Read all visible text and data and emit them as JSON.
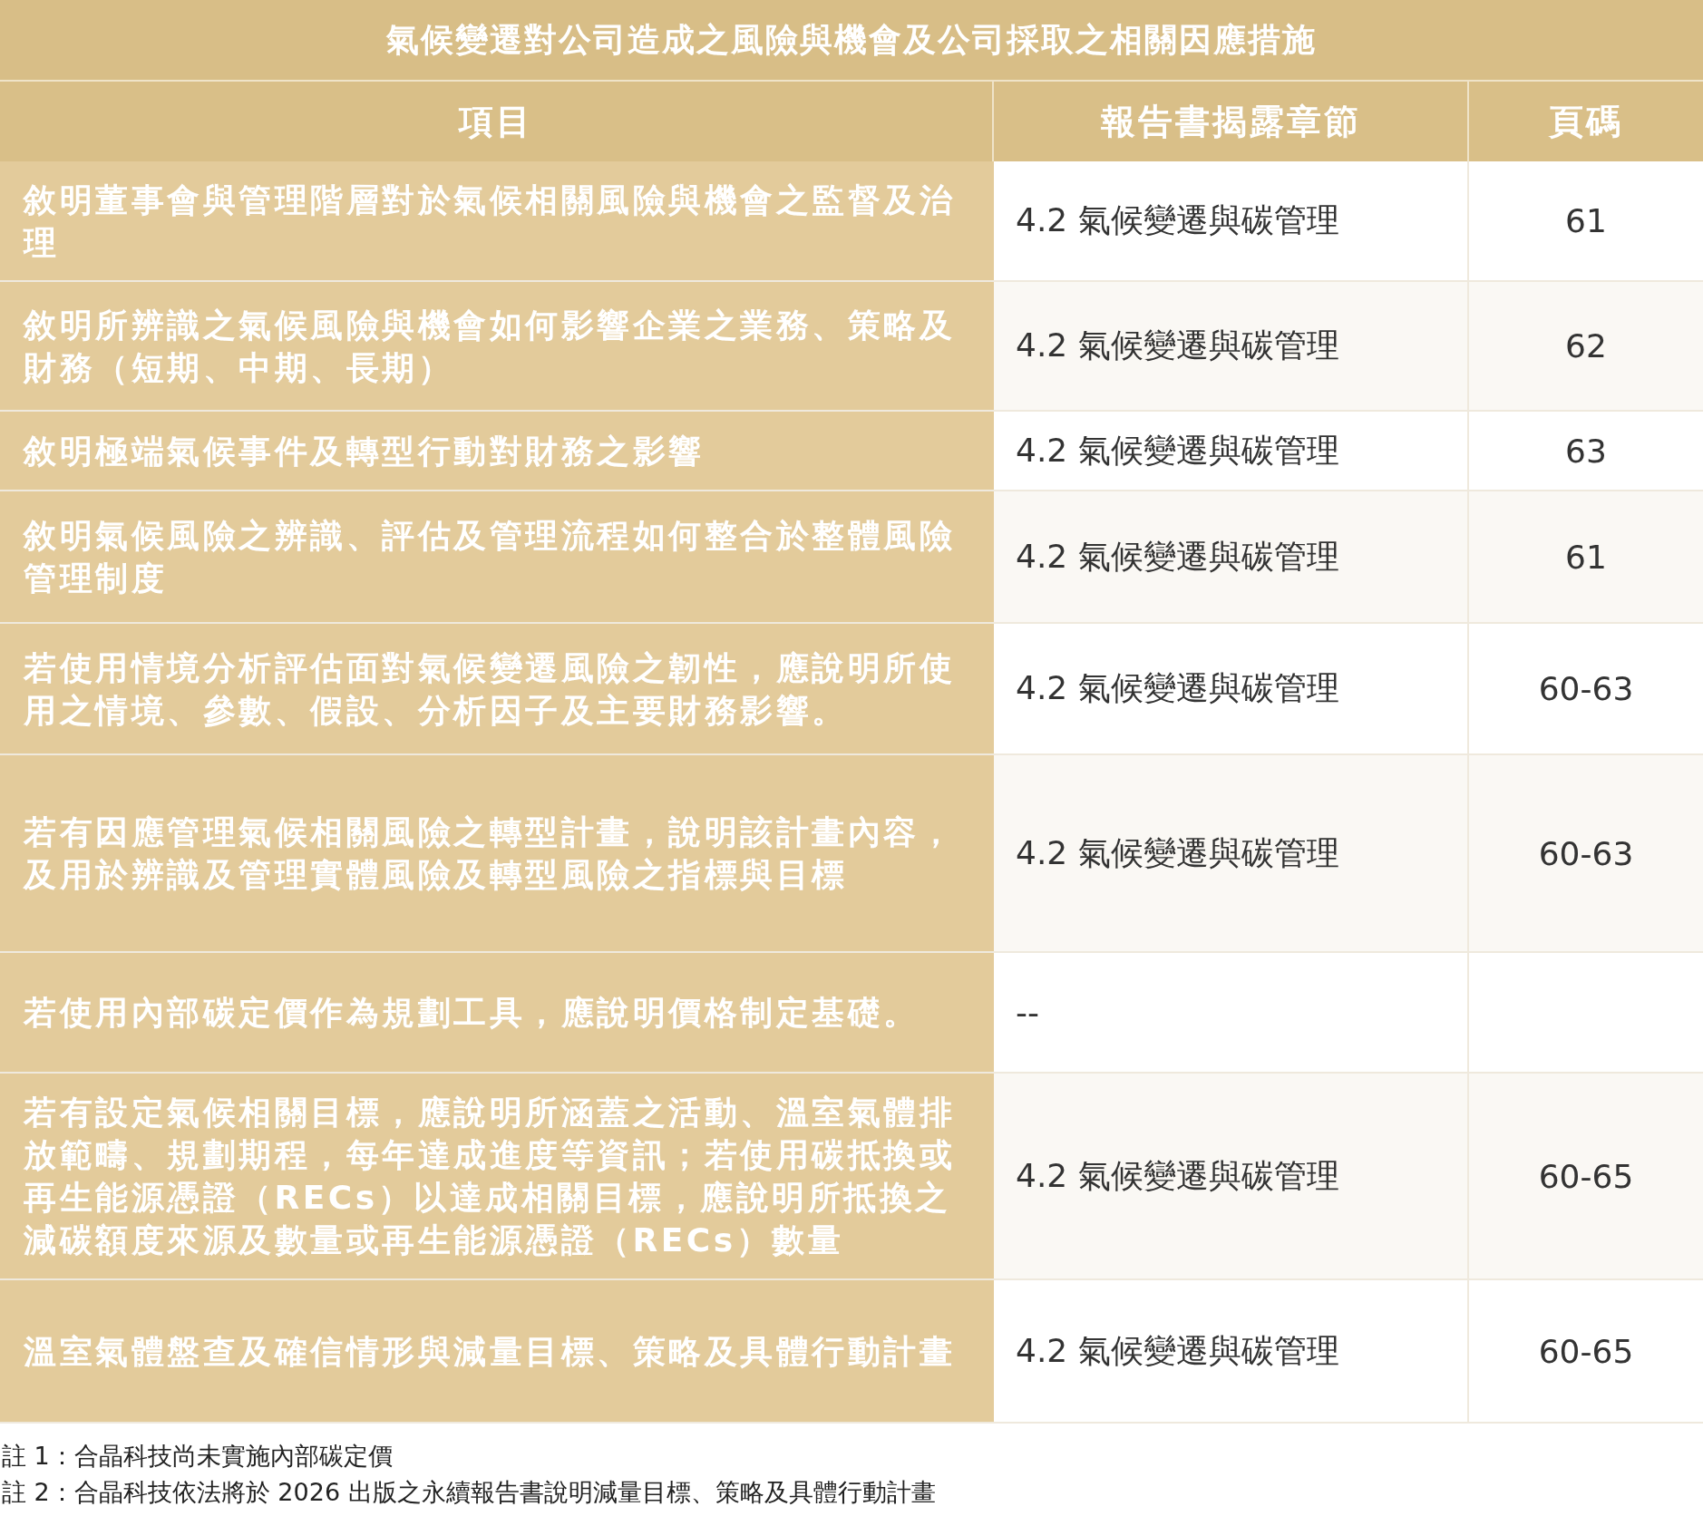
{
  "table": {
    "title": "氣候變遷對公司造成之風險與機會及公司採取之相關因應措施",
    "columns": [
      "項目",
      "報告書揭露章節",
      "頁碼"
    ],
    "rows": [
      {
        "item": "敘明董事會與管理階層對於氣候相關風險與機會之監督及治理",
        "section": "4.2 氣候變遷與碳管理",
        "page": "61"
      },
      {
        "item": "敘明所辨識之氣候風險與機會如何影響企業之業務、策略及財務（短期、中期、長期）",
        "section": "4.2 氣候變遷與碳管理",
        "page": "62"
      },
      {
        "item": "敘明極端氣候事件及轉型行動對財務之影響",
        "section": "4.2 氣候變遷與碳管理",
        "page": "63"
      },
      {
        "item": "敘明氣候風險之辨識、評估及管理流程如何整合於整體風險管理制度",
        "section": "4.2 氣候變遷與碳管理",
        "page": "61"
      },
      {
        "item": "若使用情境分析評估面對氣候變遷風險之韌性，應說明所使用之情境、參數、假設、分析因子及主要財務影響。",
        "section": "4.2 氣候變遷與碳管理",
        "page": "60-63"
      },
      {
        "item": "若有因應管理氣候相關風險之轉型計畫，說明該計畫內容，及用於辨識及管理實體風險及轉型風險之指標與目標",
        "section": "4.2 氣候變遷與碳管理",
        "page": "60-63"
      },
      {
        "item": "若使用內部碳定價作為規劃工具，應說明價格制定基礎。",
        "section": "--"
      },
      {
        "item": "若有設定氣候相關目標，應說明所涵蓋之活動、溫室氣體排放範疇、規劃期程，每年達成進度等資訊；若使用碳抵換或再生能源憑證（RECs）以達成相關目標，應說明所抵換之減碳額度來源及數量或再生能源憑證（RECs）數量",
        "section": "4.2 氣候變遷與碳管理",
        "page": "60-65"
      },
      {
        "item": "溫室氣體盤查及確信情形與減量目標、策略及具體行動計畫",
        "section": "4.2 氣候變遷與碳管理",
        "page": "60-65"
      }
    ]
  },
  "notes": [
    "註 1：合晶科技尚未實施內部碳定價",
    "註 2：合晶科技依法將於 2026 出版之永續報告書說明減量目標、策略及具體行動計畫"
  ]
}
